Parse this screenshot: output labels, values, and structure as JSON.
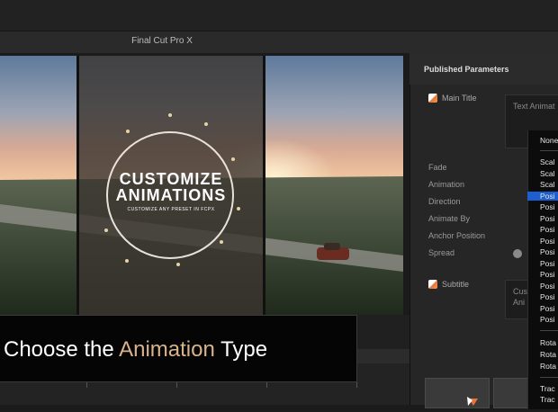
{
  "app": {
    "title": "Final Cut Pro X"
  },
  "viewer": {
    "title_main": "CUSTOMIZE",
    "title_sub": "ANIMATIONS",
    "tagline": "CUSTOMIZE ANY PRESET IN FCPX"
  },
  "caption": {
    "before": "Choose the ",
    "accent": "Animation",
    "after": " Type"
  },
  "inspector": {
    "header": "Published Parameters",
    "main_title_label": "Main Title",
    "main_title_text": "Text Animat",
    "params": [
      "Fade",
      "Animation",
      "Direction",
      "Animate By",
      "Anchor Position",
      "Spread"
    ],
    "subtitle_label": "Subtitle",
    "subtitle_text_1": "Cus",
    "subtitle_text_2": "Ani"
  },
  "dropdown": {
    "items_top": [
      "None"
    ],
    "items_group1": [
      "Scal",
      "Scal",
      "Scal",
      "Posi",
      "Posi",
      "Posi",
      "Posi",
      "Posi",
      "Posi",
      "Posi",
      "Posi",
      "Posi",
      "Posi",
      "Posi",
      "Posi"
    ],
    "items_group2": [
      "Rota",
      "Rota",
      "Rota"
    ],
    "items_group3": [
      "Trac",
      "Trac"
    ]
  },
  "colors": {
    "accent": "#d9b38c",
    "selection": "#1d5fd1"
  }
}
